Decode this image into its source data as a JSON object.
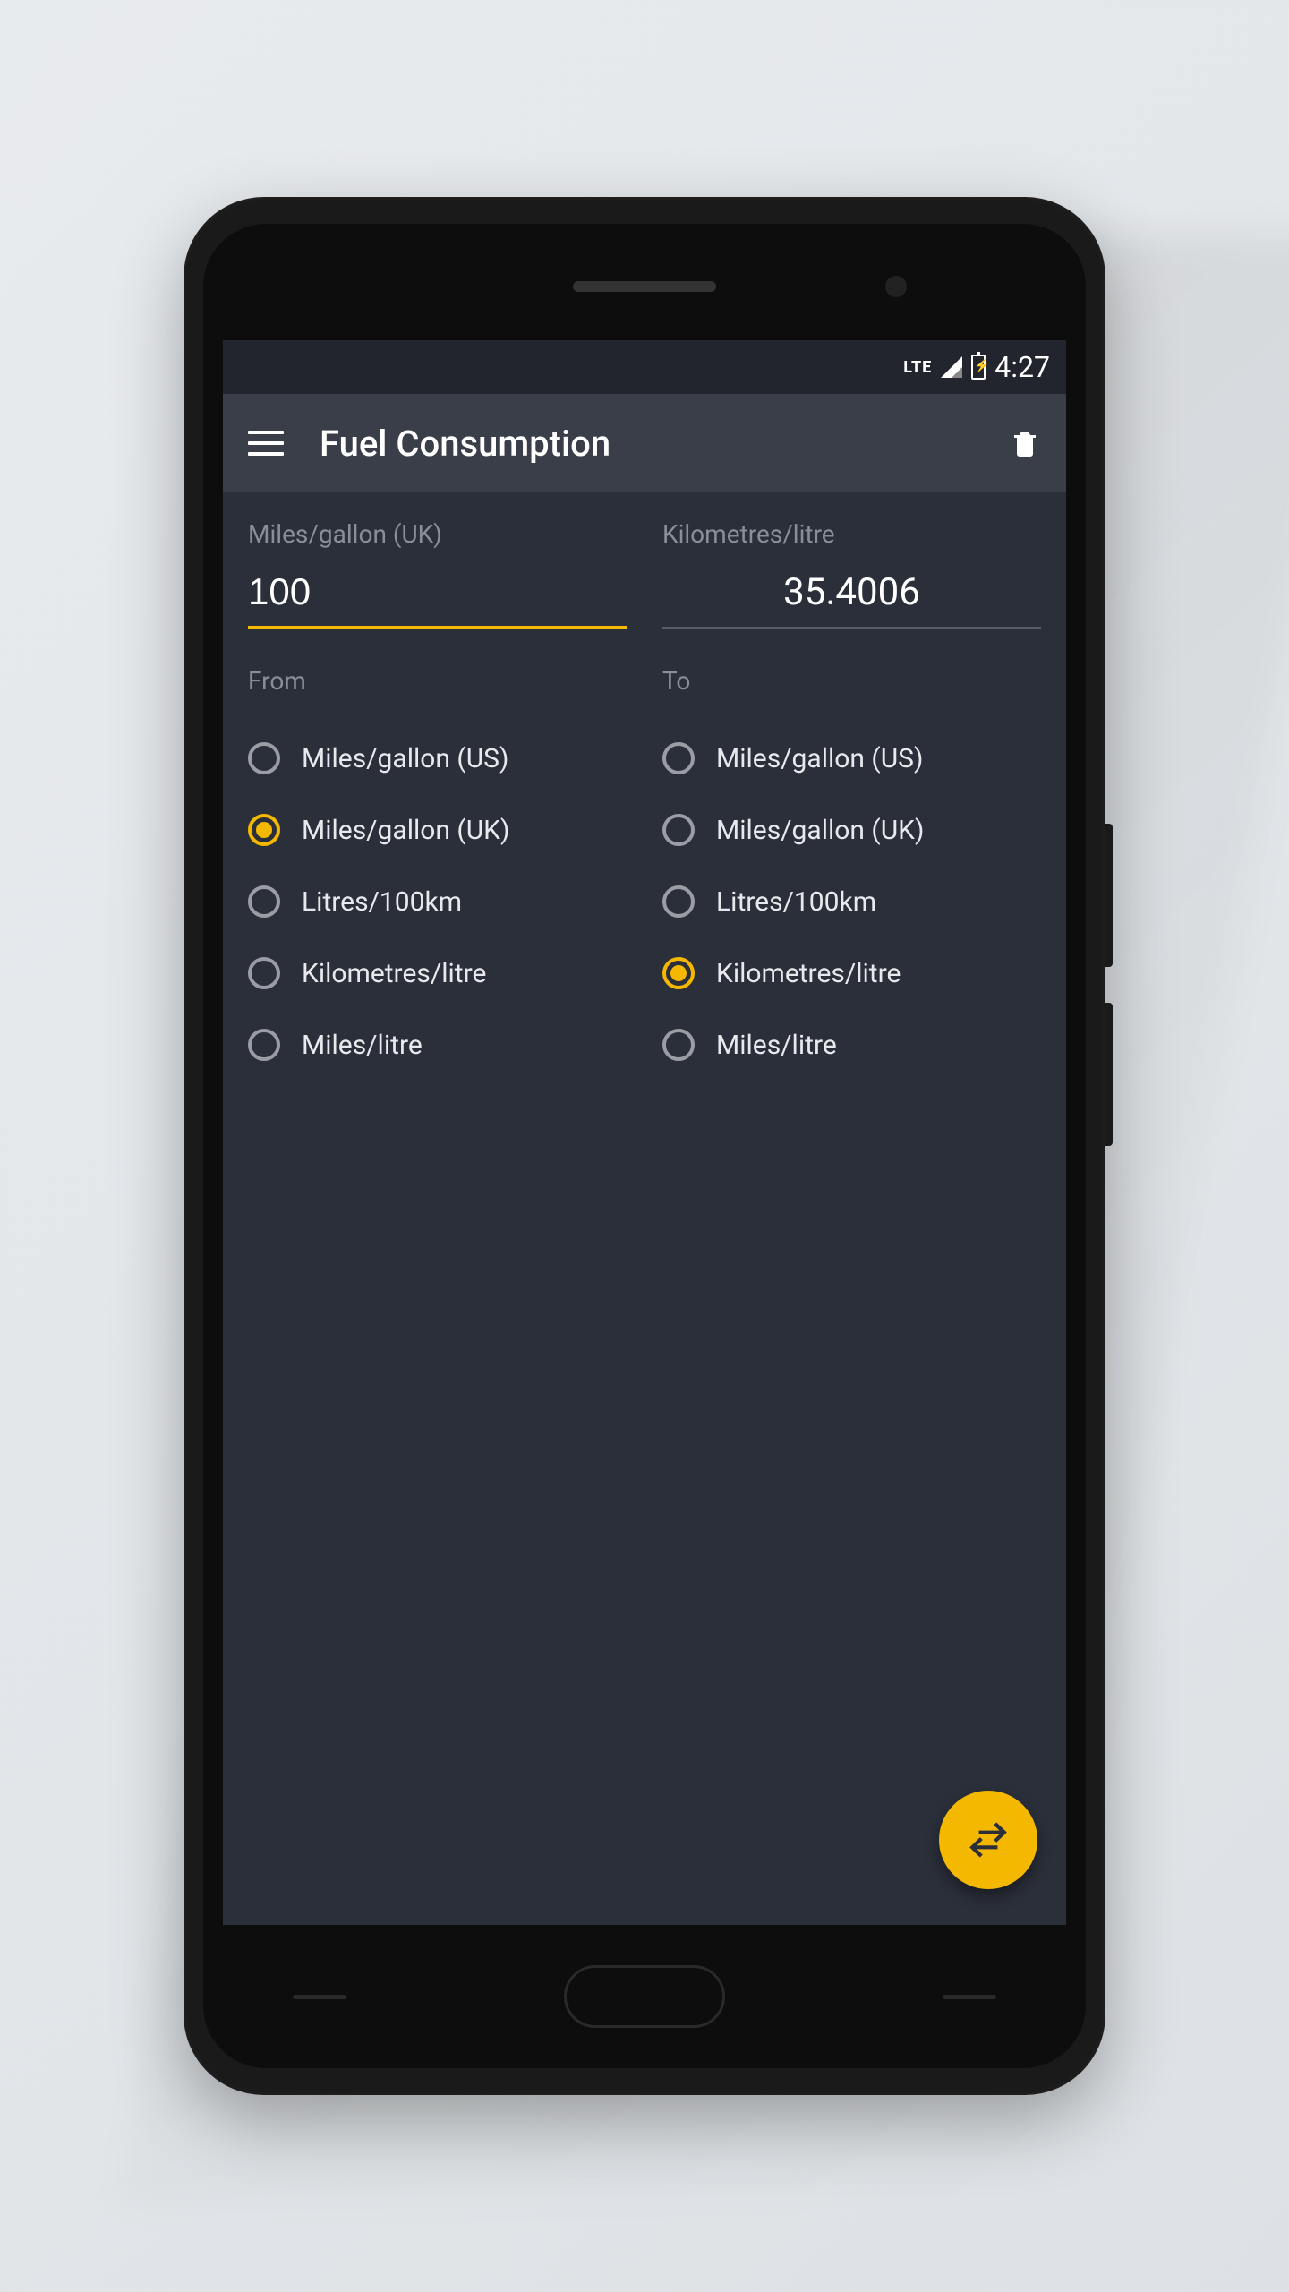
{
  "status": {
    "network": "LTE",
    "time": "4:27"
  },
  "appbar": {
    "title": "Fuel Consumption"
  },
  "converter": {
    "from_unit_label": "Miles/gallon (UK)",
    "to_unit_label": "Kilometres/litre",
    "from_value": "100",
    "to_value": "35.4006",
    "from_section": "From",
    "to_section": "To",
    "options": [
      "Miles/gallon (US)",
      "Miles/gallon (UK)",
      "Litres/100km",
      "Kilometres/litre",
      "Miles/litre"
    ],
    "from_selected_index": 1,
    "to_selected_index": 3
  },
  "colors": {
    "accent": "#f5b800",
    "bg": "#2b2f3a",
    "appbar": "#3a3e49"
  }
}
